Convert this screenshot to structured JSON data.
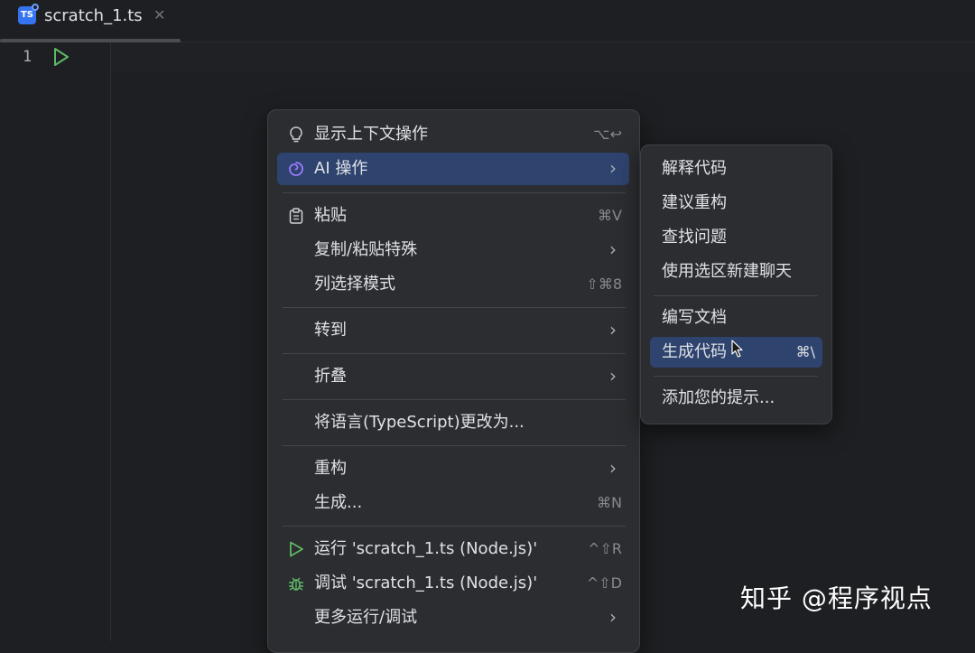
{
  "tab": {
    "icon_text": "TS",
    "label": "scratch_1.ts",
    "close": "✕"
  },
  "editor": {
    "line_number": "1"
  },
  "context_menu": {
    "show_context_actions": {
      "label": "显示上下文操作",
      "shortcut": "⌥↩"
    },
    "ai_actions": {
      "label": "AI 操作",
      "chevron": "›"
    },
    "paste": {
      "label": "粘贴",
      "shortcut": "⌘V"
    },
    "copy_paste_special": {
      "label": "复制/粘贴特殊",
      "chevron": "›"
    },
    "column_selection": {
      "label": "列选择模式",
      "shortcut": "⇧⌘8"
    },
    "go_to": {
      "label": "转到",
      "chevron": "›"
    },
    "folding": {
      "label": "折叠",
      "chevron": "›"
    },
    "change_language": {
      "label": "将语言(TypeScript)更改为..."
    },
    "refactor": {
      "label": "重构",
      "chevron": "›"
    },
    "generate": {
      "label": "生成...",
      "shortcut": "⌘N"
    },
    "run": {
      "label": "运行 'scratch_1.ts (Node.js)'",
      "shortcut": "^⇧R"
    },
    "debug": {
      "label": "调试 'scratch_1.ts (Node.js)'",
      "shortcut": "^⇧D"
    },
    "more_run_debug": {
      "label": "更多运行/调试",
      "chevron": "›"
    }
  },
  "ai_submenu": {
    "explain_code": {
      "label": "解释代码"
    },
    "suggest_refactoring": {
      "label": "建议重构"
    },
    "find_problems": {
      "label": "查找问题"
    },
    "new_chat_selection": {
      "label": "使用选区新建聊天"
    },
    "write_docs": {
      "label": "编写文档"
    },
    "generate_code": {
      "label": "生成代码",
      "shortcut": "⌘\\"
    },
    "add_prompts": {
      "label": "添加您的提示..."
    }
  },
  "watermark": "知乎 @程序视点",
  "icons": {
    "bulb": "lightbulb-icon",
    "ai": "ai-spiral-icon",
    "paste": "clipboard-icon",
    "run": "run-triangle-icon",
    "debug": "bug-icon"
  },
  "colors": {
    "background": "#1e1f22",
    "menu": "#2b2d30",
    "selection": "#2e436e",
    "run_green": "#5fb865",
    "ai_purple": "#9b7bff",
    "ts_blue": "#3574f0"
  }
}
